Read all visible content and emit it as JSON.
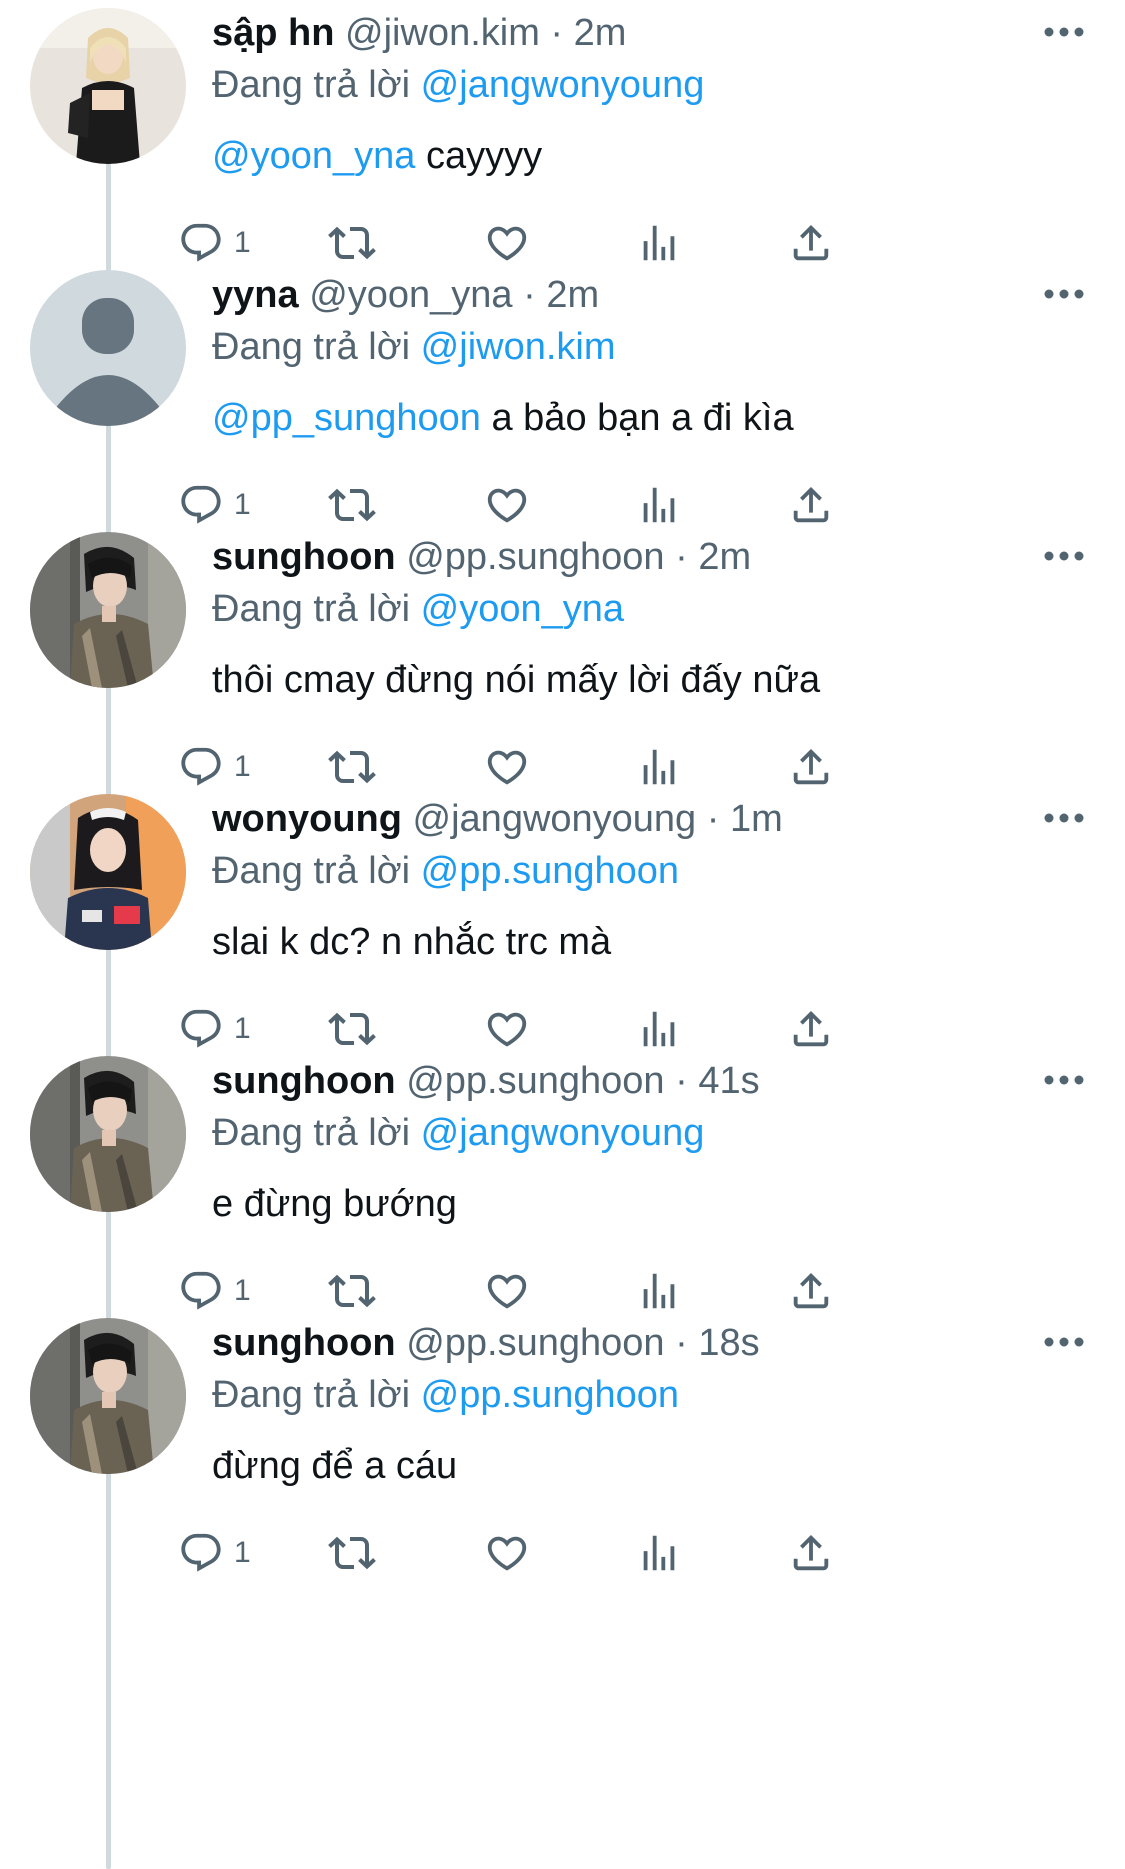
{
  "reply_prefix": "Đang trả lời",
  "colors": {
    "mention": "#1d9bf0",
    "secondary_text": "#536471",
    "thread_line": "#cfd9de"
  },
  "tweets": [
    {
      "display_name": "sập hn",
      "handle": "@jiwon.kim",
      "separator": "·",
      "time": "2m",
      "reply_to": "@jangwonyoung",
      "mention": "@yoon_yna",
      "text": " cayyyy",
      "reply_count": "1",
      "avatar": "photo-avatar-blonde"
    },
    {
      "display_name": "yyna",
      "handle": "@yoon_yna",
      "separator": "·",
      "time": "2m",
      "reply_to": "@jiwon.kim",
      "mention": "@pp_sunghoon",
      "text": " a bảo bạn a đi kìa",
      "reply_count": "1",
      "avatar": "default-avatar"
    },
    {
      "display_name": "sunghoon",
      "handle": "@pp.sunghoon",
      "separator": "·",
      "time": "2m",
      "reply_to": "@yoon_yna",
      "mention": "",
      "text": "thôi cmay đừng nói mấy lời đấy nữa",
      "reply_count": "1",
      "avatar": "photo-avatar-sunghoon"
    },
    {
      "display_name": "wonyoung",
      "handle": "@jangwonyoung",
      "separator": "·",
      "time": "1m",
      "reply_to": "@pp.sunghoon",
      "mention": "",
      "text": "slai k dc? n nhắc trc mà",
      "reply_count": "1",
      "avatar": "photo-avatar-wonyoung"
    },
    {
      "display_name": "sunghoon",
      "handle": "@pp.sunghoon",
      "separator": "·",
      "time": "41s",
      "reply_to": "@jangwonyoung",
      "mention": "",
      "text": "e đừng bướng",
      "reply_count": "1",
      "avatar": "photo-avatar-sunghoon"
    },
    {
      "display_name": "sunghoon",
      "handle": "@pp.sunghoon",
      "separator": "·",
      "time": "18s",
      "reply_to": "@pp.sunghoon",
      "mention": "",
      "text": "đừng để a cáu",
      "reply_count": "1",
      "avatar": "photo-avatar-sunghoon"
    }
  ]
}
